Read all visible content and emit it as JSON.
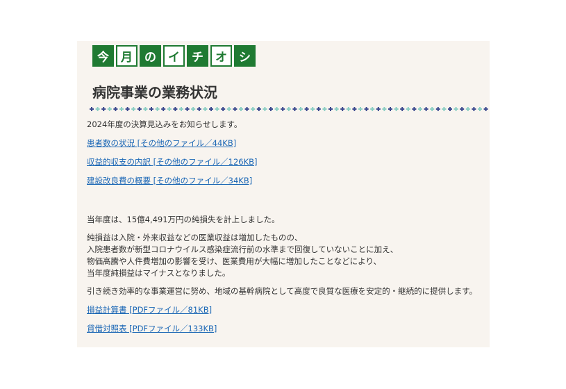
{
  "badges": [
    "今",
    "月",
    "の",
    "イ",
    "チ",
    "オ",
    "シ"
  ],
  "page_title": "病院事業の業務状況",
  "intro": "2024年度の決算見込みをお知らせします。",
  "files": [
    "患者数の状況 [その他のファイル／44KB]",
    "収益的収支の内訳 [その他のファイル／126KB]",
    "建設改良費の概要 [その他のファイル／34KB]"
  ],
  "summary": "当年度は、15億4,491万円の純損失を計上しました。",
  "explanation": [
    "純損益は入院・外来収益などの医業収益は増加したものの、",
    "入院患者数が新型コロナウイルス感染症流行前の水準まで回復していないことに加え、",
    "物価高騰や人件費増加の影響を受け、医業費用が大幅に増加したことなどにより、",
    "当年度純損益はマイナスとなりました。"
  ],
  "closing": "引き続き効率的な事業運営に努め、地域の基幹病院として高度で良質な医療を安定的・継続的に提供します。",
  "reports": [
    "損益計算書 [PDFファイル／81KB]",
    "貸借対照表 [PDFファイル／133KB]"
  ],
  "colors": {
    "badge_green": "#1f7a32",
    "link_blue": "#1a66b5",
    "panel_bg": "#f8f4ef",
    "divider_teal": "#8ccfc4",
    "divider_navy": "#3d4a8f"
  }
}
